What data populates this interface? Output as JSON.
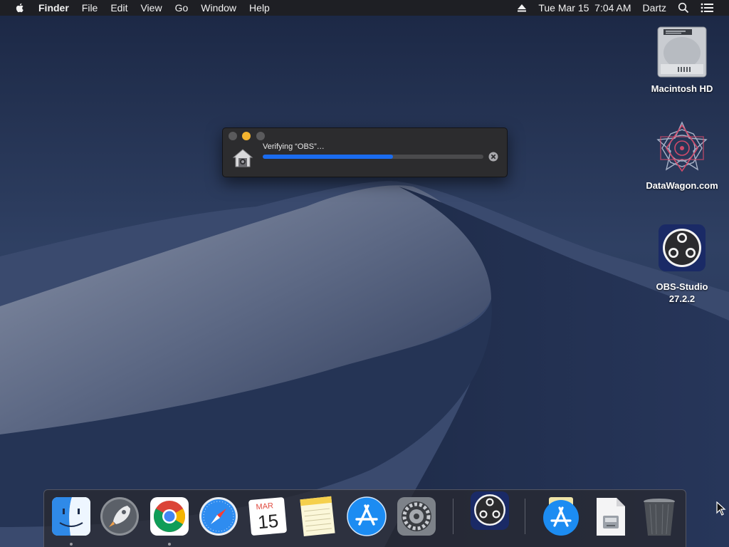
{
  "menubar": {
    "apple_icon": "apple-logo-icon",
    "app_name": "Finder",
    "menus": [
      "File",
      "Edit",
      "View",
      "Go",
      "Window",
      "Help"
    ],
    "eject_icon": "eject-icon",
    "datetime": "Tue Mar 15  7:04 AM",
    "user": "Dartz",
    "search_icon": "spotlight-search-icon",
    "notifications_icon": "notification-center-icon"
  },
  "desktop": {
    "icons": [
      {
        "label": "Macintosh HD",
        "icon": "hard-drive-icon"
      },
      {
        "label": "DataWagon.com",
        "icon": "mandala-drive-icon"
      },
      {
        "label": "OBS-Studio",
        "label2": "27.2.2",
        "icon": "obs-icon"
      }
    ]
  },
  "verify_dialog": {
    "message": "Verifying “OBS”…",
    "progress": 0.59,
    "icon": "gatekeeper-house-icon",
    "stop_icon": "stop-circle-icon"
  },
  "dock": {
    "items": [
      {
        "name": "Finder",
        "icon": "finder-icon",
        "running": true
      },
      {
        "name": "Launchpad",
        "icon": "launchpad-rocket-icon",
        "running": false
      },
      {
        "name": "Google Chrome",
        "icon": "chrome-icon",
        "running": true
      },
      {
        "name": "Safari",
        "icon": "safari-compass-icon",
        "running": false
      },
      {
        "name": "Calendar",
        "icon": "calendar-icon",
        "running": false,
        "month": "MAR",
        "day": "15"
      },
      {
        "name": "Notes",
        "icon": "notes-icon",
        "running": false
      },
      {
        "name": "App Store",
        "icon": "app-store-icon",
        "running": false
      },
      {
        "name": "System Preferences",
        "icon": "gear-icon",
        "running": false
      },
      {
        "name": "OBS",
        "icon": "obs-icon",
        "running": false
      },
      {
        "name": "Downloads",
        "icon": "downloads-stack-icon",
        "running": false
      },
      {
        "name": "Document",
        "icon": "disk-image-icon",
        "running": false
      },
      {
        "name": "Trash",
        "icon": "trash-icon",
        "running": false
      }
    ]
  },
  "colors": {
    "accent_blue": "#1a6cf0",
    "minimize_yellow": "#f4b42f",
    "menubar_bg": "#1e1e22"
  }
}
